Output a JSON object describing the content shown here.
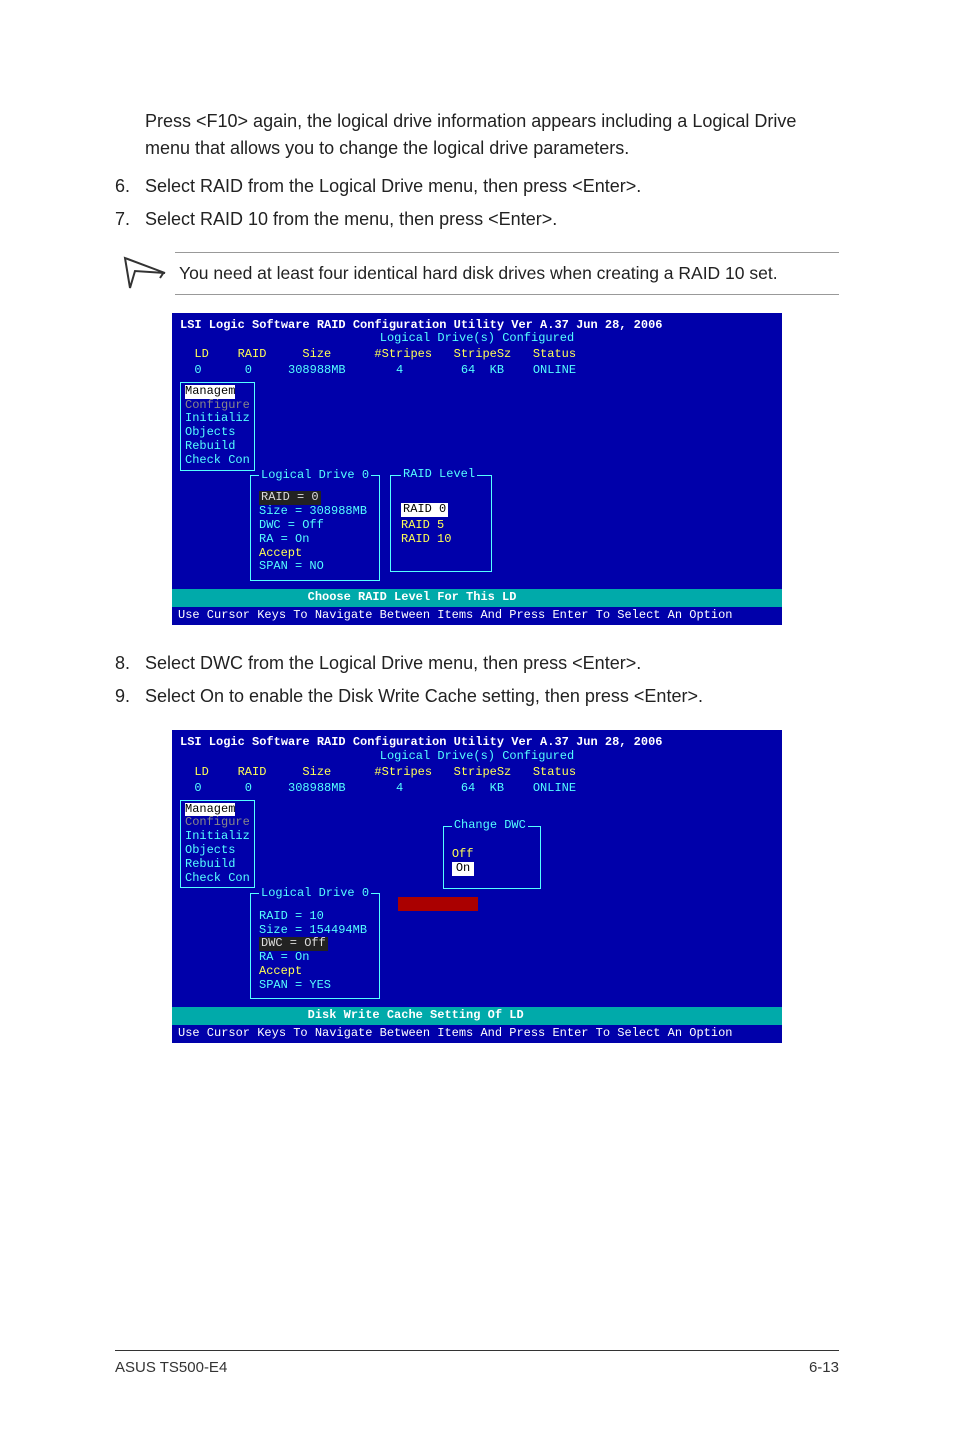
{
  "intro": {
    "p1": "Press <F10> again, the logical drive information appears including a Logical Drive menu that allows you to change the logical drive parameters."
  },
  "steps_top": [
    {
      "n": "6.",
      "t": "Select RAID from the Logical Drive menu, then press <Enter>."
    },
    {
      "n": "7.",
      "t": "Select RAID 10 from the menu, then press <Enter>."
    }
  ],
  "note_text": "You need at least four identical hard disk drives when creating a RAID 10 set.",
  "bios1": {
    "title": "LSI Logic Software RAID Configuration Utility Ver A.37 Jun 28, 2006",
    "subtitle": "Logical Drive(s) Configured",
    "headers": "  LD    RAID     Size      #Stripes   StripeSz   Status",
    "row": "  0      0     308988MB       4        64  KB    ONLINE",
    "side_menu": [
      "Managem",
      "Configure",
      "Initializ",
      "Objects",
      "Rebuild",
      "Check Con"
    ],
    "ld_box": {
      "title": "Logical Drive 0",
      "lines": [
        "RAID = 0",
        "Size = 308988MB",
        "DWC  = Off",
        "RA   = On",
        "Accept",
        "SPAN = NO"
      ]
    },
    "raid_box": {
      "title": "RAID Level",
      "items": [
        "RAID 0",
        "RAID 5",
        "RAID 10"
      ]
    },
    "status": "Choose RAID Level For This LD",
    "help": "Use Cursor Keys To Navigate Between Items And Press Enter To Select An Option"
  },
  "steps_bottom": [
    {
      "n": "8.",
      "t": "Select DWC from the Logical Drive menu, then press <Enter>."
    },
    {
      "n": "9.",
      "t": "Select On to enable the Disk Write Cache setting, then press <Enter>."
    }
  ],
  "bios2": {
    "title": "LSI Logic Software RAID Configuration Utility Ver A.37 Jun 28, 2006",
    "subtitle": "Logical Drive(s) Configured",
    "headers": "  LD    RAID     Size      #Stripes   StripeSz   Status",
    "row": "  0      0     308988MB       4        64  KB    ONLINE",
    "side_menu": [
      "Managem",
      "Configure",
      "Initializ",
      "Objects",
      "Rebuild",
      "Check Con"
    ],
    "ld_box": {
      "title": "Logical Drive 0",
      "lines": [
        "RAID = 10",
        "Size = 154494MB",
        "DWC  = Off",
        "RA   = On",
        "Accept",
        "SPAN = YES"
      ]
    },
    "dwc_popup": {
      "title": "Change DWC",
      "items": [
        "Off",
        "On"
      ]
    },
    "status": "Disk Write Cache Setting Of LD",
    "help": "Use Cursor Keys To Navigate Between Items And Press Enter To Select An Option"
  },
  "footer": {
    "left": "ASUS TS500-E4",
    "right": "6-13"
  }
}
